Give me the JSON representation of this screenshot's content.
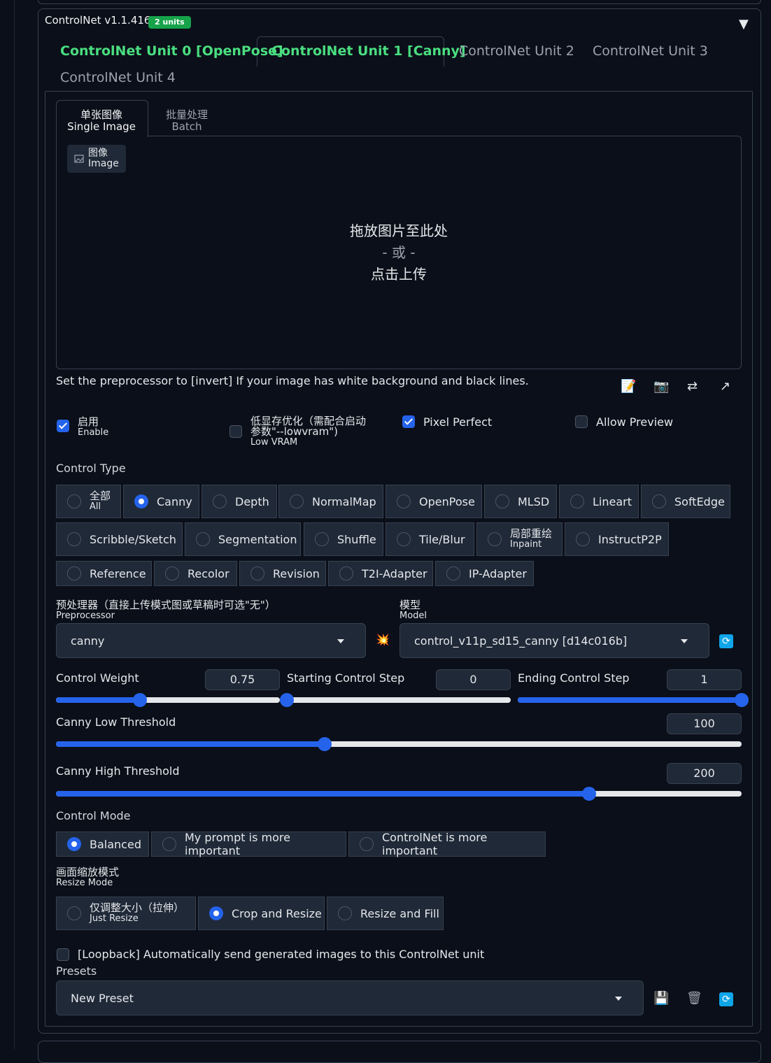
{
  "header": {
    "title": "ControlNet v1.1.416",
    "badge": "2 units"
  },
  "unit_tabs": [
    {
      "label": "ControlNet Unit 0 [OpenPose]"
    },
    {
      "label": "ControlNet Unit 1 [Canny]"
    },
    {
      "label": "ControlNet Unit 2"
    },
    {
      "label": "ControlNet Unit 3"
    },
    {
      "label": "ControlNet Unit 4"
    }
  ],
  "image_tabs": {
    "single_zh": "单张图像",
    "single_en": "Single Image",
    "batch_zh": "批量处理",
    "batch_en": "Batch"
  },
  "upload": {
    "chip_zh": "图像",
    "chip_en": "Image",
    "drop_line1": "拖放图片至此处",
    "drop_or": "- 或 -",
    "drop_line3": "点击上传"
  },
  "hint": "Set the preprocessor to [invert] If your image has white background and black lines.",
  "toolbar": {
    "edit_icon": "📝",
    "camera_icon": "📷",
    "swap_icon": "⇄",
    "send_icon": "↗"
  },
  "options": {
    "enable_zh": "启用",
    "enable_en": "Enable",
    "enable_checked": true,
    "lowvram_zh1": "低显存优化（需配合启动",
    "lowvram_zh2": "参数\"--lowvram\")",
    "lowvram_en": "Low VRAM",
    "lowvram_checked": false,
    "pixel_perfect": "Pixel Perfect",
    "pixel_perfect_checked": true,
    "allow_preview": "Allow Preview",
    "allow_preview_checked": false
  },
  "control_type": {
    "label": "Control Type",
    "all_zh": "全部",
    "all_en": "All",
    "inpaint_zh": "局部重绘",
    "inpaint_en": "Inpaint",
    "items": [
      "Canny",
      "Depth",
      "NormalMap",
      "OpenPose",
      "MLSD",
      "Lineart",
      "SoftEdge",
      "Scribble/Sketch",
      "Segmentation",
      "Shuffle",
      "Tile/Blur",
      "InstructP2P",
      "Reference",
      "Recolor",
      "Revision",
      "T2I-Adapter",
      "IP-Adapter"
    ],
    "selected": "Canny"
  },
  "preprocessor": {
    "label_zh": "预处理器（直接上传模式图或草稿时可选\"无\"）",
    "label_en": "Preprocessor",
    "value": "canny"
  },
  "model": {
    "label_zh": "模型",
    "label_en": "Model",
    "value": "control_v11p_sd15_canny [d14c016b]"
  },
  "run_icon": "💥",
  "refresh_icon": "🔄",
  "sliders": {
    "control_weight": {
      "label": "Control Weight",
      "value": "0.75",
      "fraction": 0.375
    },
    "start_step": {
      "label": "Starting Control Step",
      "value": "0",
      "fraction": 0.0
    },
    "end_step": {
      "label": "Ending Control Step",
      "value": "1",
      "fraction": 1.0
    },
    "canny_low": {
      "label": "Canny Low Threshold",
      "value": "100",
      "fraction": 0.392
    },
    "canny_high": {
      "label": "Canny High Threshold",
      "value": "200",
      "fraction": 0.778
    }
  },
  "control_mode": {
    "label": "Control Mode",
    "options": [
      "Balanced",
      "My prompt is more important",
      "ControlNet is more important"
    ],
    "selected": "Balanced"
  },
  "resize_mode": {
    "label_zh": "画面缩放模式",
    "label_en": "Resize Mode",
    "just_resize_zh": "仅调整大小（拉伸）",
    "just_resize_en": "Just Resize",
    "crop": "Crop and Resize",
    "fill": "Resize and Fill",
    "selected": "Crop and Resize"
  },
  "loopback": {
    "label": "[Loopback] Automatically send generated images to this ControlNet unit",
    "checked": false
  },
  "presets": {
    "label": "Presets",
    "value": "New Preset",
    "save_icon": "💾",
    "delete_icon": "🗑"
  }
}
